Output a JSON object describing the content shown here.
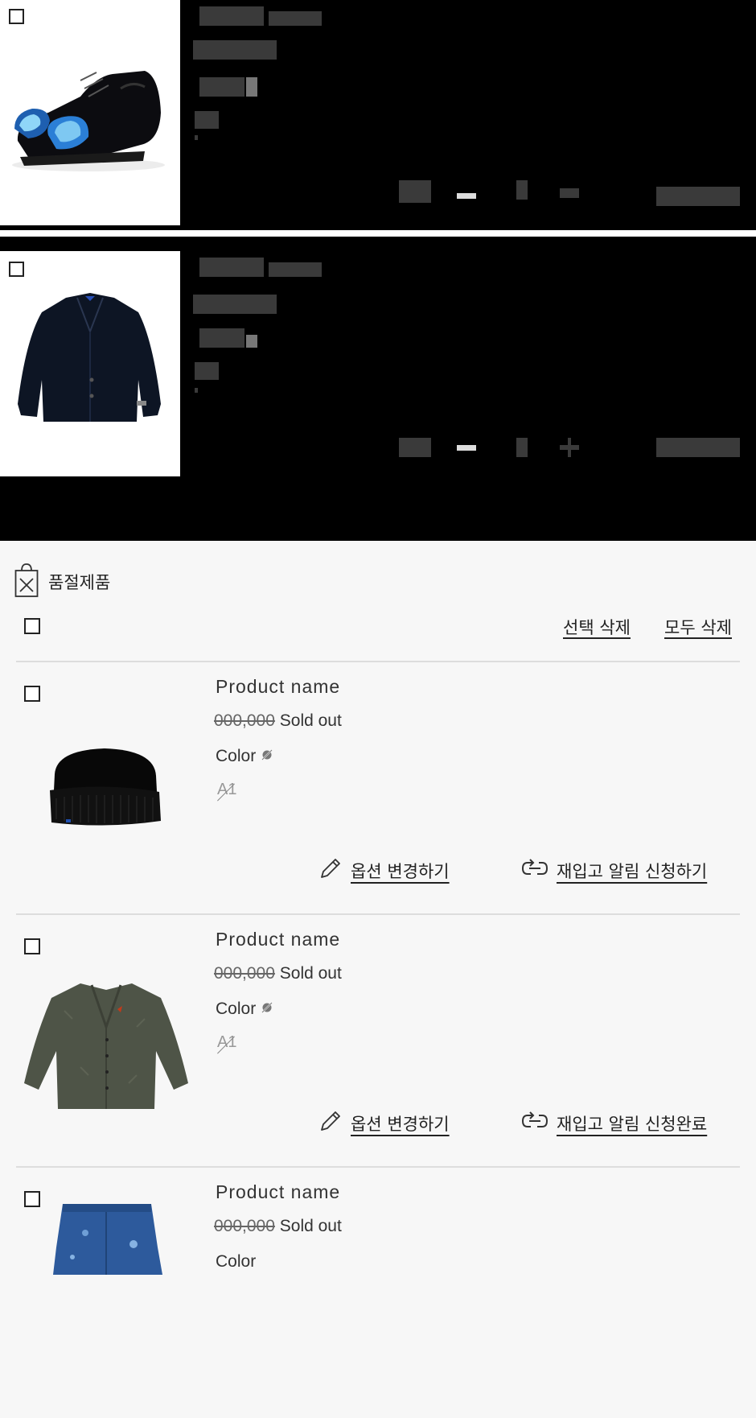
{
  "soldout_section": {
    "title": "품절제품",
    "delete_selected": "선택 삭제",
    "delete_all": "모두 삭제"
  },
  "soldout_items": [
    {
      "name": "Product name",
      "price": "000,000",
      "status": "Sold out",
      "color_label": "Color",
      "size": "A1",
      "change_option": "옵션 변경하기",
      "restock_alert": "재입고 알림 신청하기"
    },
    {
      "name": "Product name",
      "price": "000,000",
      "status": "Sold out",
      "color_label": "Color",
      "size": "A1",
      "change_option": "옵션 변경하기",
      "restock_alert": "재입고 알림 신청완료"
    },
    {
      "name": "Product name",
      "price": "000,000",
      "status": "Sold out",
      "color_label": "Color"
    }
  ],
  "icons": {
    "soldout": "shopping-bag-x-icon",
    "edit": "pencil-icon",
    "restock": "link-refresh-icon"
  }
}
